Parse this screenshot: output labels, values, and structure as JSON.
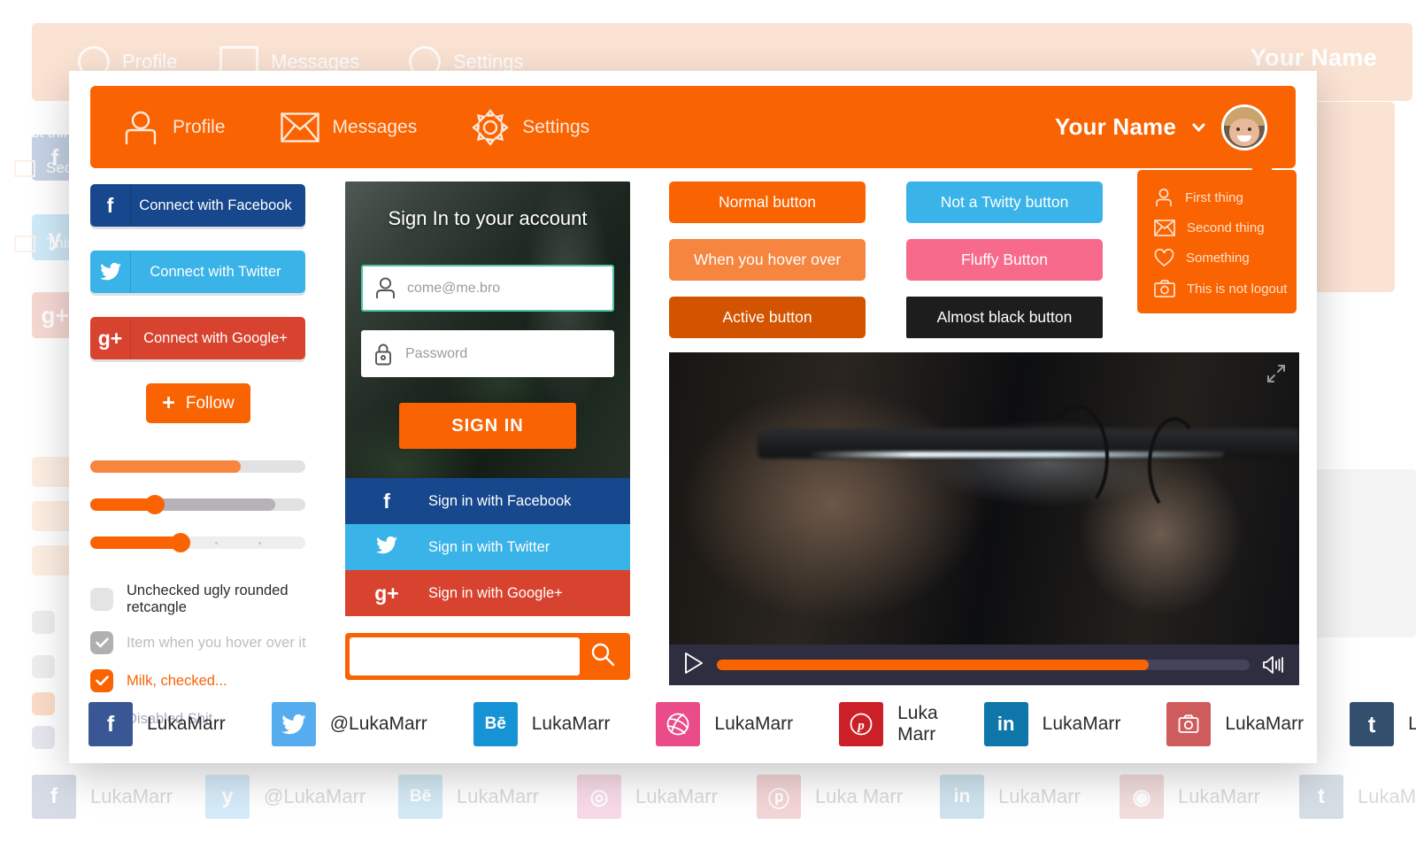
{
  "theme": {
    "orange": "#f96302",
    "orange_light": "#f5853f",
    "orange_dark": "#d35400",
    "facebook_blue": "#17478c",
    "twitter_blue": "#3ab3e8",
    "google_red": "#d8432f",
    "pink": "#f76a8c",
    "almost_black": "#1d1d1d"
  },
  "topbar": {
    "nav": [
      {
        "label": "Profile",
        "icon": "user-icon"
      },
      {
        "label": "Messages",
        "icon": "envelope-icon"
      },
      {
        "label": "Settings",
        "icon": "gear-icon"
      }
    ],
    "user_name": "Your Name",
    "chevron_icon": "chevron-down-icon",
    "avatar_icon": "avatar"
  },
  "connect_buttons": [
    {
      "label": "Connect with Facebook",
      "glyph": "f",
      "style": "fb"
    },
    {
      "label": "Connect with Twitter",
      "glyph": "twitter-bird-icon",
      "style": "tw"
    },
    {
      "label": "Connect with Google+",
      "glyph": "g+",
      "style": "gp"
    }
  ],
  "follow_button": {
    "label": "Follow",
    "plus": "+"
  },
  "sliders": [
    {
      "name": "slider-no-handle",
      "value": 70,
      "handle": false,
      "mid": 0,
      "ticks": false
    },
    {
      "name": "slider-with-handle",
      "value": 30,
      "handle": true,
      "mid": 86,
      "ticks": false
    },
    {
      "name": "slider-stepped",
      "value": 42,
      "handle": true,
      "mid": 0,
      "ticks": true
    }
  ],
  "checkboxes": [
    {
      "label": "Unchecked ugly rounded retcangle",
      "state": "unchecked"
    },
    {
      "label": "Item when you hover over it",
      "state": "hover"
    },
    {
      "label": "Milk, checked...",
      "state": "checked"
    },
    {
      "label": "Disabled Shit",
      "state": "disabled"
    }
  ],
  "signin": {
    "title": "Sign In to your account",
    "email_placeholder": "come@me.bro",
    "email_value": "",
    "password_placeholder": "Password",
    "password_value": "",
    "submit_label": "SIGN IN",
    "email_icon": "user-icon",
    "password_icon": "lock-icon"
  },
  "social_signin": [
    {
      "label": "Sign in with Facebook",
      "glyph": "f",
      "style": "fb"
    },
    {
      "label": "Sign in with Twitter",
      "glyph": "twitter-bird-icon",
      "style": "tw"
    },
    {
      "label": "Sign in with Google+",
      "glyph": "g+",
      "style": "gp"
    }
  ],
  "search": {
    "value": "",
    "placeholder": "",
    "icon": "search-icon"
  },
  "demo_buttons": [
    {
      "label": "Normal button",
      "style": "normal"
    },
    {
      "label": "Not a Twitty button",
      "style": "twitter"
    },
    {
      "label": "When you hover over",
      "style": "hover"
    },
    {
      "label": "Fluffy Button",
      "style": "fluffy"
    },
    {
      "label": "Active button",
      "style": "active"
    },
    {
      "label": "Almost black button",
      "style": "black"
    }
  ],
  "dropdown": [
    {
      "label": "First thing",
      "icon": "user-icon"
    },
    {
      "label": "Second thing",
      "icon": "envelope-icon"
    },
    {
      "label": "Something",
      "icon": "heart-icon"
    },
    {
      "label": "This is not logout",
      "icon": "camera-icon"
    }
  ],
  "video": {
    "play_icon": "play-icon",
    "volume_icon": "volume-icon",
    "expand_icon": "expand-icon",
    "progress_percent": 81
  },
  "footer": [
    {
      "network": "facebook",
      "glyph": "f",
      "handle": "LukaMarr",
      "color": "#3a5795"
    },
    {
      "network": "twitter",
      "glyph": "twitter-bird-icon",
      "handle": "@LukaMarr",
      "color": "#55acee"
    },
    {
      "network": "behance",
      "glyph": "Bē",
      "handle": "LukaMarr",
      "color": "#1693d4"
    },
    {
      "network": "dribbble",
      "glyph": "dribbble-icon",
      "handle": "LukaMarr",
      "color": "#ea4c89"
    },
    {
      "network": "pinterest",
      "glyph": "pinterest-icon",
      "handle": "Luka Marr",
      "color": "#cb2027"
    },
    {
      "network": "linkedin",
      "glyph": "in",
      "handle": "LukaMarr",
      "color": "#0e76a8"
    },
    {
      "network": "instagram",
      "glyph": "camera-icon",
      "handle": "LukaMarr",
      "color": "#cf5c5c"
    },
    {
      "network": "tumblr",
      "glyph": "t",
      "handle": "LukaMarr",
      "color": "#32506d"
    }
  ]
}
